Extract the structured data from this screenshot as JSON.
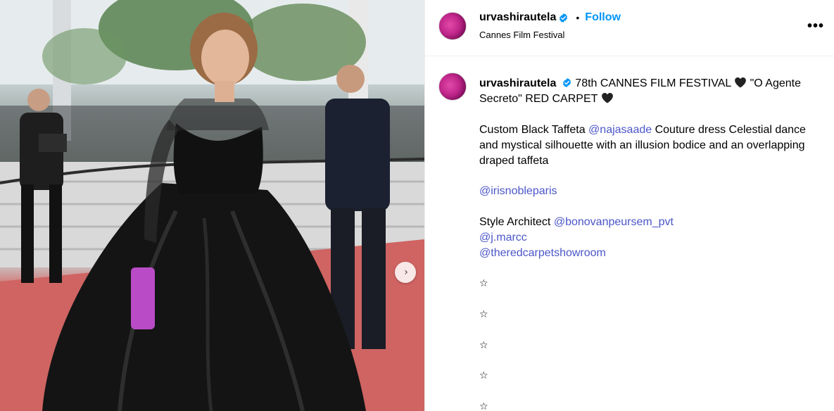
{
  "post": {
    "username": "urvashirautela",
    "follow_label": "Follow",
    "separator": "•",
    "location": "Cannes Film Festival",
    "more_label": "•••",
    "carousel_next": "›"
  },
  "caption": {
    "username": "urvashirautela",
    "line1_text": "78th CANNES FILM FESTIVAL",
    "line1_text_b": "\"O Agente Secreto\" RED CARPET",
    "heart_icon": "black-heart-emoji",
    "para2_prefix": "Custom Black Taffeta",
    "mention_najasaade": "@najasaade",
    "para2_suffix": "Couture dress Celestial dance and mystical silhouette with an illusion bodice and an overlapping draped taffeta",
    "mention_irisnobleparis": "@irisnobleparis",
    "style_architect_label": "Style Architect",
    "mention_bonovanpeursem": "@bonovanpeursem_pvt",
    "mention_jmarcc": "@j.marcc",
    "mention_theredcarpetshowroom": "@theredcarpetshowroom",
    "stars": [
      "☆",
      "☆",
      "☆",
      "☆",
      "☆"
    ]
  },
  "colors": {
    "link": "#4b56c8",
    "follow": "#0095f6",
    "verified": "#0095f6",
    "avatar_accent": "#c0268a"
  }
}
